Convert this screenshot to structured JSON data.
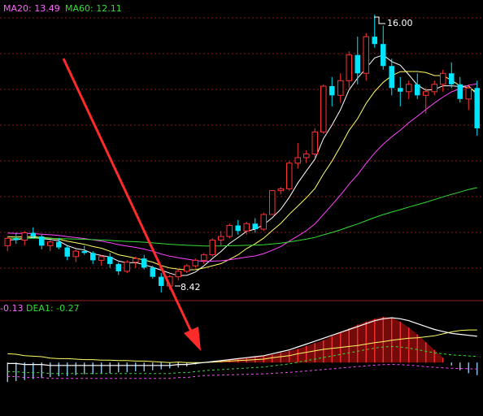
{
  "chart_data": [
    {
      "type": "candlestick",
      "legend": [
        {
          "text": "MA20: 13.49",
          "color": "#ff44ff"
        },
        {
          "text": "MA60: 12.11",
          "color": "#33dd33"
        }
      ],
      "annotations": {
        "high_label": "16.00",
        "low_label": "8.42"
      },
      "ylim": [
        8.2,
        16.4
      ],
      "grid": true,
      "colors": {
        "up": "#ff3333",
        "down": "#00e5ff",
        "ma5": "#ffffff",
        "ma10": "#ffff66",
        "ma20": "#ff44ff",
        "ma60": "#33dd33",
        "arrow": "#ff2a2a"
      },
      "candles": [
        [
          9.7,
          9.95,
          9.55,
          9.9
        ],
        [
          9.9,
          10.05,
          9.75,
          9.85
        ],
        [
          9.85,
          10.1,
          9.7,
          10.05
        ],
        [
          10.05,
          10.2,
          9.9,
          9.95
        ],
        [
          9.95,
          10.0,
          9.6,
          9.7
        ],
        [
          9.7,
          9.85,
          9.55,
          9.8
        ],
        [
          9.8,
          9.9,
          9.6,
          9.65
        ],
        [
          9.65,
          9.7,
          9.3,
          9.4
        ],
        [
          9.4,
          9.6,
          9.25,
          9.55
        ],
        [
          9.55,
          9.7,
          9.45,
          9.5
        ],
        [
          9.5,
          9.55,
          9.2,
          9.3
        ],
        [
          9.3,
          9.45,
          9.15,
          9.4
        ],
        [
          9.4,
          9.5,
          9.1,
          9.2
        ],
        [
          9.2,
          9.25,
          8.9,
          9.0
        ],
        [
          9.0,
          9.3,
          8.95,
          9.25
        ],
        [
          9.25,
          9.4,
          9.1,
          9.35
        ],
        [
          9.35,
          9.45,
          9.05,
          9.1
        ],
        [
          9.1,
          9.15,
          8.8,
          8.85
        ],
        [
          8.85,
          8.95,
          8.42,
          8.6
        ],
        [
          8.6,
          8.9,
          8.5,
          8.85
        ],
        [
          8.85,
          9.05,
          8.75,
          9.0
        ],
        [
          9.0,
          9.2,
          8.95,
          9.15
        ],
        [
          9.15,
          9.35,
          9.1,
          9.3
        ],
        [
          9.3,
          9.5,
          9.2,
          9.45
        ],
        [
          9.45,
          9.9,
          9.4,
          9.85
        ],
        [
          9.85,
          10.1,
          9.7,
          9.95
        ],
        [
          9.95,
          10.3,
          9.9,
          10.25
        ],
        [
          10.25,
          10.4,
          10.0,
          10.1
        ],
        [
          10.1,
          10.35,
          10.0,
          10.3
        ],
        [
          10.3,
          10.45,
          10.05,
          10.15
        ],
        [
          10.15,
          10.6,
          10.1,
          10.55
        ],
        [
          10.55,
          11.2,
          10.55,
          11.2
        ],
        [
          11.2,
          11.3,
          11.1,
          11.25
        ],
        [
          11.25,
          12.0,
          11.2,
          11.95
        ],
        [
          11.95,
          12.5,
          11.8,
          12.1
        ],
        [
          12.1,
          12.3,
          11.95,
          12.2
        ],
        [
          12.2,
          12.9,
          12.1,
          12.8
        ],
        [
          12.8,
          14.1,
          12.75,
          14.05
        ],
        [
          14.05,
          14.3,
          13.5,
          13.8
        ],
        [
          13.8,
          14.4,
          13.6,
          14.2
        ],
        [
          14.2,
          15.0,
          14.0,
          14.9
        ],
        [
          14.9,
          15.4,
          14.1,
          14.4
        ],
        [
          14.4,
          15.5,
          14.2,
          15.4
        ],
        [
          15.4,
          16.0,
          15.1,
          15.2
        ],
        [
          15.2,
          15.7,
          14.5,
          14.6
        ],
        [
          14.6,
          14.8,
          13.8,
          14.0
        ],
        [
          14.0,
          14.3,
          13.5,
          13.9
        ],
        [
          13.9,
          14.2,
          13.7,
          14.1
        ],
        [
          14.1,
          14.4,
          13.7,
          13.8
        ],
        [
          13.8,
          14.0,
          13.3,
          13.9
        ],
        [
          13.9,
          14.2,
          13.8,
          14.1
        ],
        [
          14.1,
          14.5,
          13.9,
          14.4
        ],
        [
          14.4,
          14.7,
          14.0,
          14.1
        ],
        [
          14.1,
          14.3,
          13.6,
          13.7
        ],
        [
          13.7,
          14.1,
          13.4,
          14.0
        ],
        [
          14.0,
          14.2,
          12.7,
          12.9
        ]
      ]
    },
    {
      "type": "macd",
      "legend": [
        {
          "text": "-0.13",
          "color": "#ff44ff"
        },
        {
          "text": "DEA1: -0.27",
          "color": "#33dd33"
        }
      ],
      "ylim": [
        -0.55,
        0.62
      ],
      "histogram": [
        -0.2,
        -0.19,
        -0.18,
        -0.17,
        -0.16,
        -0.15,
        -0.14,
        -0.14,
        -0.13,
        -0.12,
        -0.12,
        -0.11,
        -0.11,
        -0.1,
        -0.1,
        -0.09,
        -0.09,
        -0.08,
        -0.07,
        -0.06,
        -0.05,
        -0.04,
        -0.02,
        0.0,
        0.01,
        0.02,
        0.03,
        0.04,
        0.05,
        0.06,
        0.07,
        0.08,
        0.1,
        0.12,
        0.14,
        0.17,
        0.2,
        0.23,
        0.27,
        0.31,
        0.35,
        0.39,
        0.42,
        0.45,
        0.47,
        0.46,
        0.42,
        0.36,
        0.29,
        0.21,
        0.13,
        0.05,
        -0.03,
        -0.08,
        -0.11,
        -0.13
      ],
      "dif": [
        -0.01,
        -0.01,
        -0.02,
        -0.02,
        -0.02,
        -0.03,
        -0.03,
        -0.03,
        -0.03,
        -0.03,
        -0.03,
        -0.03,
        -0.03,
        -0.03,
        -0.03,
        -0.03,
        -0.03,
        -0.03,
        -0.03,
        -0.03,
        -0.02,
        -0.02,
        -0.01,
        0.0,
        0.01,
        0.02,
        0.03,
        0.04,
        0.05,
        0.06,
        0.07,
        0.09,
        0.11,
        0.13,
        0.16,
        0.19,
        0.22,
        0.25,
        0.28,
        0.31,
        0.34,
        0.37,
        0.4,
        0.43,
        0.45,
        0.46,
        0.45,
        0.43,
        0.4,
        0.37,
        0.34,
        0.32,
        0.3,
        0.29,
        0.28,
        0.27
      ]
    }
  ]
}
